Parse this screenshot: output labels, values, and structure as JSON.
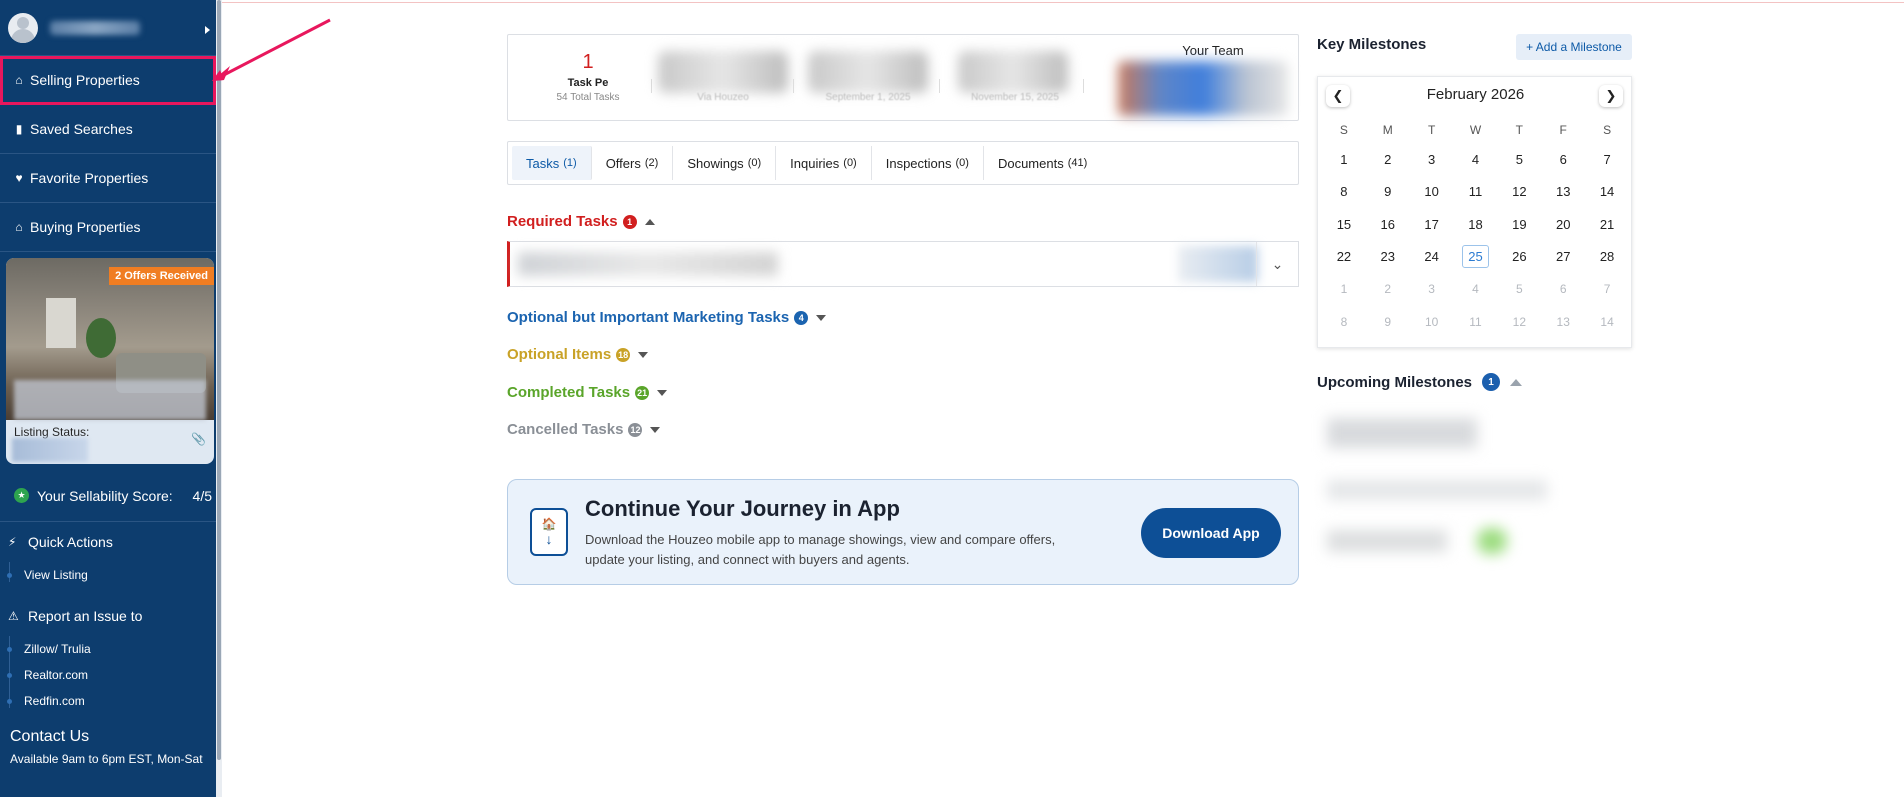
{
  "sidebar": {
    "items": [
      {
        "label": "Selling Properties",
        "icon": "home-icon"
      },
      {
        "label": "Saved Searches",
        "icon": "bookmark-icon"
      },
      {
        "label": "Favorite Properties",
        "icon": "heart-icon"
      },
      {
        "label": "Buying Properties",
        "icon": "home-icon"
      }
    ],
    "property_card": {
      "badge": "2 Offers Received",
      "status_label": "Listing Status:"
    },
    "sellability": {
      "label": "Your Sellability Score:",
      "value": "4/5"
    },
    "quick_actions": {
      "title": "Quick Actions",
      "items": [
        "View Listing"
      ]
    },
    "report_issue": {
      "title": "Report an Issue to",
      "items": [
        "Zillow/ Trulia",
        "Realtor.com",
        "Redfin.com"
      ]
    },
    "contact": {
      "title": "Contact Us",
      "hours": "Available 9am to 6pm EST, Mon-Sat"
    }
  },
  "summary": {
    "task_count": "1",
    "task_label": "Task Pe",
    "task_total": "54 Total Tasks",
    "col2_sub": "Via Houzeo",
    "col3_sub": "September 1, 2025",
    "col4_sub": "November 15, 2025",
    "team_label": "Your Team"
  },
  "tabs": [
    {
      "label": "Tasks",
      "count": "(1)"
    },
    {
      "label": "Offers",
      "count": "(2)"
    },
    {
      "label": "Showings",
      "count": "(0)"
    },
    {
      "label": "Inquiries",
      "count": "(0)"
    },
    {
      "label": "Inspections",
      "count": "(0)"
    },
    {
      "label": "Documents",
      "count": "(41)"
    }
  ],
  "sections": {
    "required": {
      "label": "Required Tasks",
      "count": "1",
      "color": "#d11f1f"
    },
    "marketing": {
      "label": "Optional but Important Marketing Tasks",
      "count": "4",
      "color": "#1b64b0"
    },
    "optional": {
      "label": "Optional Items",
      "count": "18",
      "color": "#c9a227"
    },
    "completed": {
      "label": "Completed Tasks",
      "count": "21",
      "color": "#5aa52a"
    },
    "cancelled": {
      "label": "Cancelled Tasks",
      "count": "12",
      "color": "#8a8f96"
    }
  },
  "app_banner": {
    "title": "Continue Your Journey in App",
    "description": "Download the Houzeo mobile app to manage showings, view and compare offers, update your listing, and connect with buyers and agents.",
    "button": "Download App"
  },
  "milestones": {
    "title": "Key Milestones",
    "add_button": "+ Add a Milestone",
    "calendar_month": "February 2026",
    "weekdays": [
      "S",
      "M",
      "T",
      "W",
      "T",
      "F",
      "S"
    ],
    "days": [
      "1",
      "2",
      "3",
      "4",
      "5",
      "6",
      "7",
      "8",
      "9",
      "10",
      "11",
      "12",
      "13",
      "14",
      "15",
      "16",
      "17",
      "18",
      "19",
      "20",
      "21",
      "22",
      "23",
      "24",
      "25",
      "26",
      "27",
      "28"
    ],
    "next_days": [
      "1",
      "2",
      "3",
      "4",
      "5",
      "6",
      "7",
      "8",
      "9",
      "10",
      "11",
      "12",
      "13",
      "14"
    ],
    "today": "25",
    "upcoming_title": "Upcoming Milestones",
    "upcoming_count": "1"
  },
  "colors": {
    "sidebar_bg": "#0d3d6e",
    "accent": "#0d4f96",
    "highlight": "#e8175d"
  }
}
